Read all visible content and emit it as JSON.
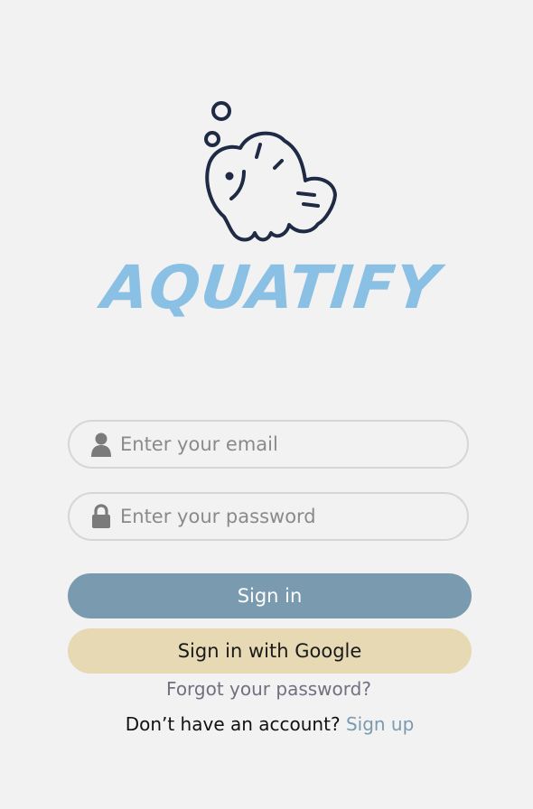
{
  "app": {
    "name": "AQUATIFY"
  },
  "login": {
    "email_placeholder": "Enter your email",
    "password_placeholder": "Enter your password",
    "signin_label": "Sign in",
    "google_label": "Sign in with Google",
    "forgot_label": "Forgot your password?",
    "no_account_text": "Don’t have an account?",
    "signup_label": "Sign up"
  },
  "icons": {
    "logo": "fish-icon",
    "email": "user-icon",
    "password": "lock-icon"
  },
  "colors": {
    "background": "#f2f2f2",
    "wordmark": "#89c0e4",
    "logo_stroke": "#1f2a44",
    "signin_button": "#7a9aaf",
    "google_button": "#e6d9b4",
    "signup_link": "#7a9aaf",
    "forgot_link": "#707080",
    "input_border": "#d6d6d6",
    "icon": "#7b7b7b"
  }
}
